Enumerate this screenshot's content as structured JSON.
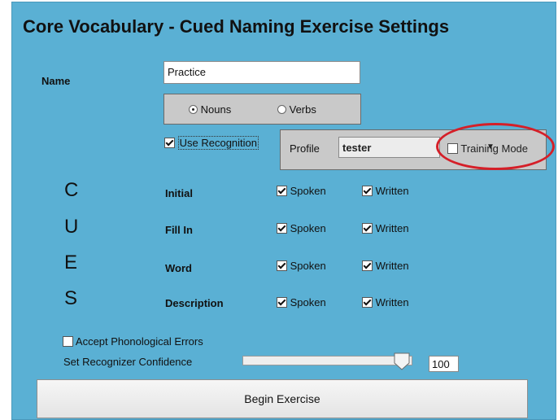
{
  "title": "Core Vocabulary - Cued Naming Exercise Settings",
  "name": {
    "label": "Name",
    "value": "Practice"
  },
  "word_type": {
    "options": [
      "Nouns",
      "Verbs"
    ],
    "selected": "Nouns"
  },
  "recognition": {
    "label": "Use Recognition",
    "checked": true
  },
  "profile": {
    "label": "Profile",
    "value": "tester"
  },
  "training_mode": {
    "label": "Training Mode",
    "checked": false,
    "highlight_color": "#d51f28"
  },
  "cues": {
    "letters": [
      "C",
      "U",
      "E",
      "S"
    ],
    "spoken_label": "Spoken",
    "written_label": "Written",
    "rows": [
      {
        "label": "Initial",
        "spoken": true,
        "written": true
      },
      {
        "label": "Fill In",
        "spoken": true,
        "written": true
      },
      {
        "label": "Word",
        "spoken": true,
        "written": true
      },
      {
        "label": "Description",
        "spoken": true,
        "written": true
      }
    ]
  },
  "phonological": {
    "label": "Accept Phonological Errors",
    "checked": false
  },
  "confidence": {
    "label": "Set Recognizer Confidence",
    "value": "100",
    "level": 1.0
  },
  "begin_button": {
    "label": "Begin Exercise"
  },
  "colors": {
    "panel_bg": "#5ab0d4",
    "group_bg": "#c9c9c9"
  }
}
